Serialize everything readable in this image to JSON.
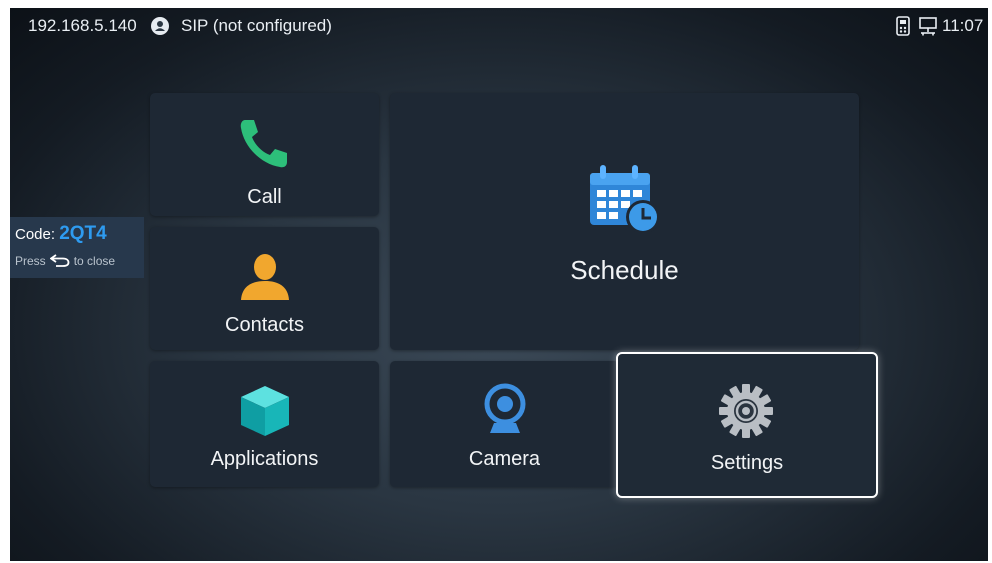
{
  "status_bar": {
    "ip": "192.168.5.140",
    "sip_status": "SIP (not configured)",
    "time": "11:07",
    "icons": [
      "user-icon",
      "remote-control-icon",
      "network-icon"
    ]
  },
  "tiles": {
    "call": {
      "label": "Call",
      "icon": "phone-icon"
    },
    "contacts": {
      "label": "Contacts",
      "icon": "person-icon"
    },
    "schedule": {
      "label": "Schedule",
      "icon": "calendar-clock-icon"
    },
    "applications": {
      "label": "Applications",
      "icon": "cube-icon"
    },
    "camera": {
      "label": "Camera",
      "icon": "webcam-icon"
    },
    "settings": {
      "label": "Settings",
      "icon": "gear-icon",
      "selected": true
    }
  },
  "code_panel": {
    "code_label": "Code:",
    "code_value": "2QT4",
    "press_text": "Press",
    "close_text": "to close"
  },
  "colors": {
    "accent": "#2e9bf0",
    "tile_bg": "#1e2834",
    "phone_green": "#2dbf7a",
    "contacts_orange": "#f1a72e",
    "cube_teal": "#18b6b8",
    "calendar_blue": "#2f86d8",
    "camera_blue": "#3d8fe0"
  }
}
